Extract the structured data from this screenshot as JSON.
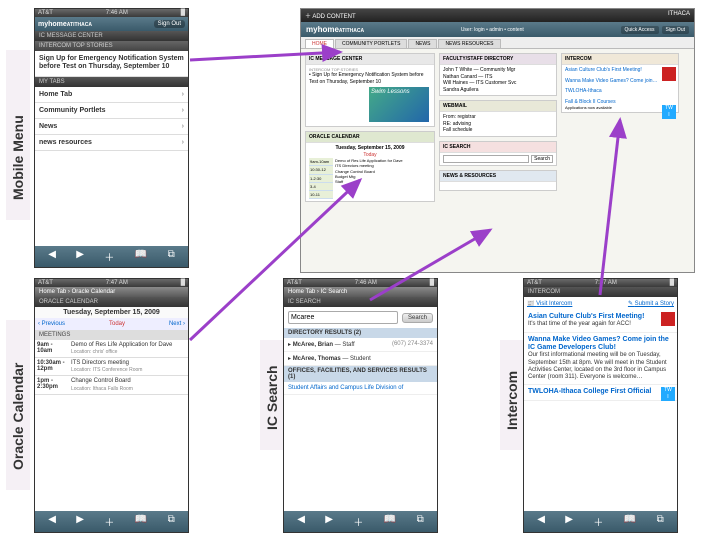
{
  "labels": {
    "mobile_menu": "Mobile Menu",
    "oracle_calendar": "Oracle Calendar",
    "ic_search": "IC Search",
    "intercom": "Intercom"
  },
  "status": {
    "carrier": "AT&T",
    "battery": "█"
  },
  "times": {
    "menu": "7:46 AM",
    "cal": "7:47 AM",
    "search": "7:46 AM",
    "intercom": "7:47 AM"
  },
  "brand": {
    "prefix": "my",
    "word": "home",
    "suffix": "ATITHACA"
  },
  "buttons": {
    "sign_out": "Sign Out",
    "search": "Search",
    "quick_access": "Quick Access",
    "add_content": "ADD CONTENT",
    "prev": "‹ Previous",
    "today": "Today",
    "next": "Next ›"
  },
  "menu_phone": {
    "section1": "IC Message Center",
    "section2": "Intercom Top Stories",
    "story": "Sign Up for Emergency Notification System before Test on Thursday, September 10",
    "mytabs": "My Tabs",
    "items": [
      "Home Tab",
      "Community Portlets",
      "News",
      "news resources"
    ]
  },
  "cal_phone": {
    "crumb": "Home Tab › Oracle Calendar",
    "section": "Oracle Calendar",
    "date": "Tuesday, September 15, 2009",
    "meetings_hdr": "MEETINGS",
    "rows": [
      {
        "time": "9am - 10am",
        "title": "Demo of Res Life Application for Dave",
        "loc": "Location: chris' office"
      },
      {
        "time": "10:30am - 12pm",
        "title": "ITS Directors meeting",
        "loc": "Location: ITS Conference Room"
      },
      {
        "time": "1pm - 2:30pm",
        "title": "Change Control Board",
        "loc": "Location: Ithaca Falls Room"
      }
    ]
  },
  "search_phone": {
    "crumb": "Home Tab › IC Search",
    "section": "IC Search",
    "query": "Mcaree",
    "dir_hdr": "Directory Results (2)",
    "results": [
      {
        "name": "McAree, Brian",
        "role": "Staff",
        "phone": "(607) 274-3374"
      },
      {
        "name": "McAree, Thomas",
        "role": "Student",
        "phone": ""
      }
    ],
    "svc_hdr": "Offices, Facilities, and Services Results (1)",
    "svc": "Student Affairs and Campus Life Division of"
  },
  "intercom_phone": {
    "section": "Intercom",
    "visit": "Visit Intercom",
    "submit": "Submit a Story",
    "items": [
      {
        "hl": "Asian Culture Club's First Meeting!",
        "body": "It's that time of the year again for ACC!"
      },
      {
        "hl": "Wanna Make Video Games? Come join the IC Game Developers Club!",
        "body": "Our first informational meeting will be on Tuesday, September 15th at 8pm. We will meet in the Student Activities Center, located on the 3rd floor in Campus Center (room 311). Everyone is welcome…"
      },
      {
        "hl": "TWLOHA-Ithaca College First Official",
        "body": ""
      }
    ]
  },
  "desktop": {
    "title_right": "ITHACA",
    "user": "User: login • admin • content",
    "tabs": [
      "HOME",
      "COMMUNITY PORTLETS",
      "NEWS",
      "NEWS RESOURCES"
    ],
    "msg": {
      "hdr": "IC MESSAGE CENTER",
      "sub": "Intercom Top Stories",
      "story": "• Sign Up for Emergency Notification System before Test on Thursday, September 10"
    },
    "swim": "Swim Lessons",
    "cal": {
      "hdr": "ORACLE CALENDAR",
      "date": "Tuesday, September 15, 2009",
      "today": "Today",
      "side": [
        "9am-10am",
        "10:30-12",
        "1-2:30",
        "3-4",
        "10-11"
      ],
      "body_items": [
        "Demo of Res Life Application for Dave",
        "ITS Directors meeting",
        "Change Control Board",
        "Budget Mtg",
        "Staff"
      ]
    },
    "dir": {
      "hdr": "FACULTY/STAFF DIRECTORY",
      "rows": [
        "John T White — Community Mgr",
        "Nathan Canard — ITS",
        "Will Haines — ITS Customer Svc",
        "Sandra Aguilera"
      ]
    },
    "web": {
      "hdr": "WEBMAIL",
      "rows": [
        "From: registrar",
        "RE: advising",
        "Fall schedule"
      ]
    },
    "int": {
      "hdr": "INTERCOM",
      "rows": [
        "Asian Culture Club's First Meeting!",
        "Wanna Make Video Games? Come join…",
        "TWLOHA-Ithaca",
        "Fall & Block II Courses",
        "Applications now available"
      ]
    },
    "srch": {
      "hdr": "IC SEARCH",
      "ph": "Search"
    },
    "res": {
      "hdr": "NEWS & RESOURCES"
    }
  },
  "toolbar_icons": [
    "◀",
    "▶",
    "＋",
    "📖",
    "⧉"
  ]
}
